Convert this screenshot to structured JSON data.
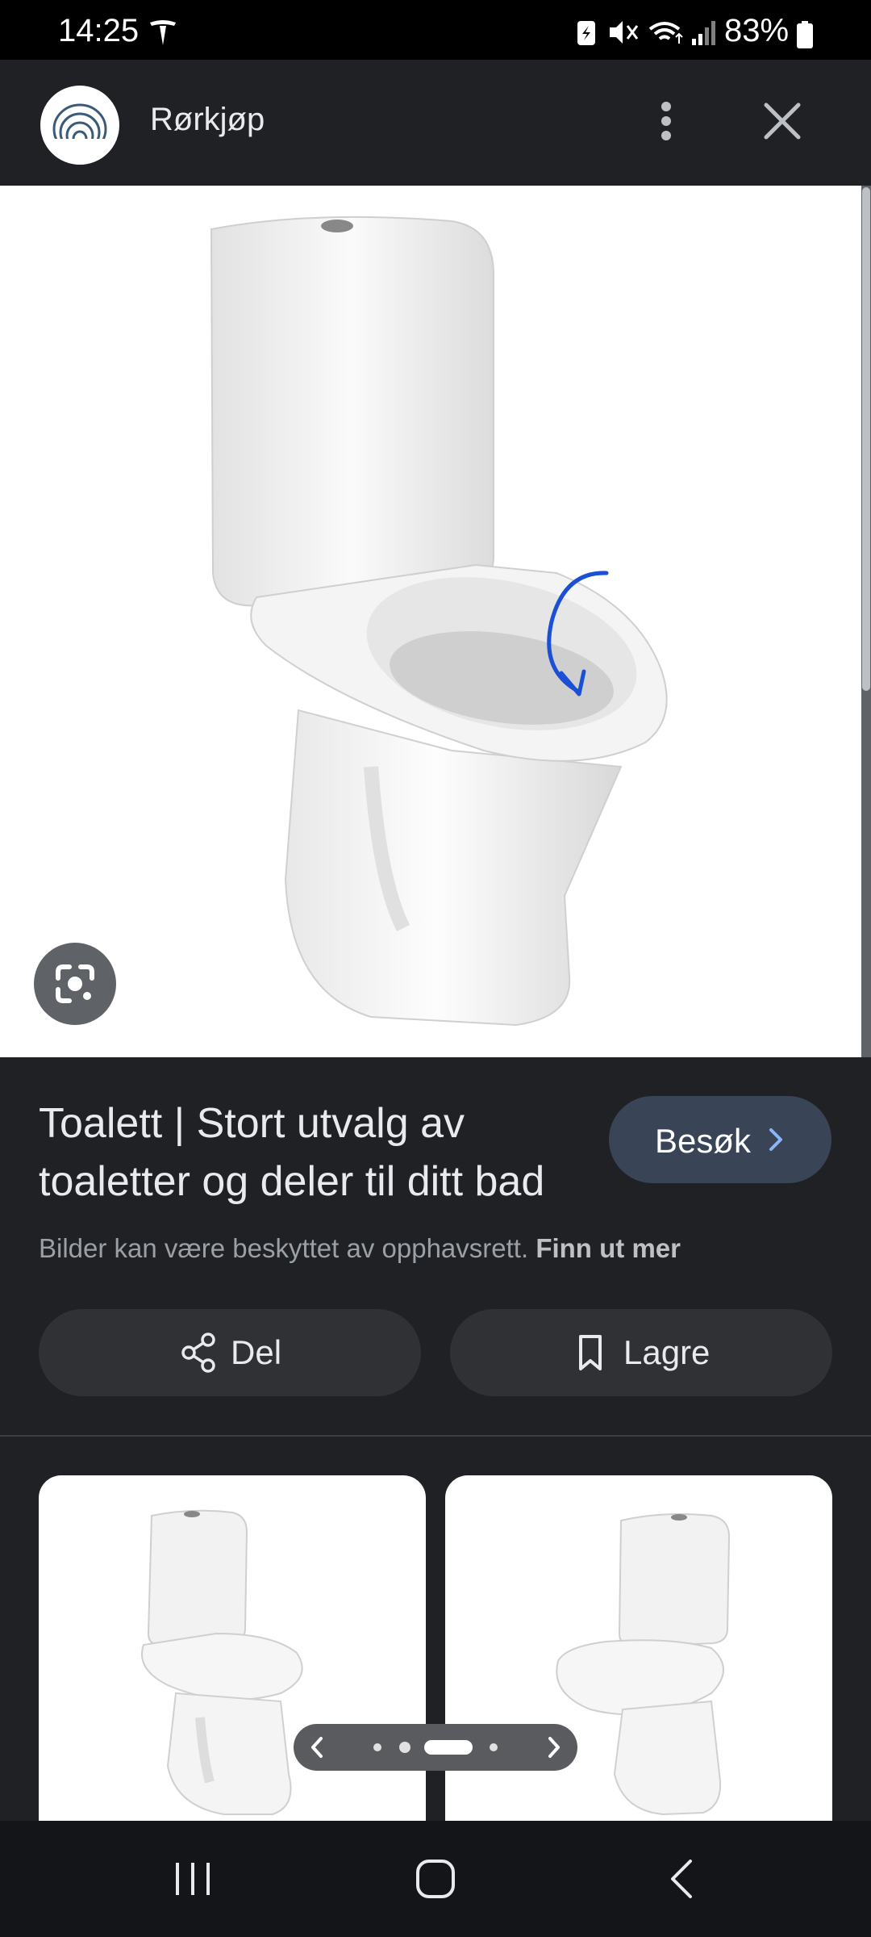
{
  "status_bar": {
    "time": "14:25",
    "battery": "83%",
    "icons": [
      "tesla-icon",
      "battery-saver-icon",
      "mute-icon",
      "wifi-icon",
      "signal-icon",
      "battery-icon"
    ]
  },
  "header": {
    "site_name": "Rørkjøp",
    "logo_icon": "site-logo-rings",
    "actions": [
      "more-vert-icon",
      "close-icon"
    ]
  },
  "result": {
    "title": "Toalett | Stort utvalg av toaletter og deler til ditt bad",
    "visit_label": "Besøk",
    "copyright_text": "Bilder kan være beskyttet av opphavsrett.",
    "copyright_link": "Finn ut mer",
    "share_label": "Del",
    "save_label": "Lagre"
  },
  "colors": {
    "background": "#202124",
    "visit_button": "#394457",
    "pill_button": "#303134",
    "annotation_stroke": "#1a4fd6"
  }
}
